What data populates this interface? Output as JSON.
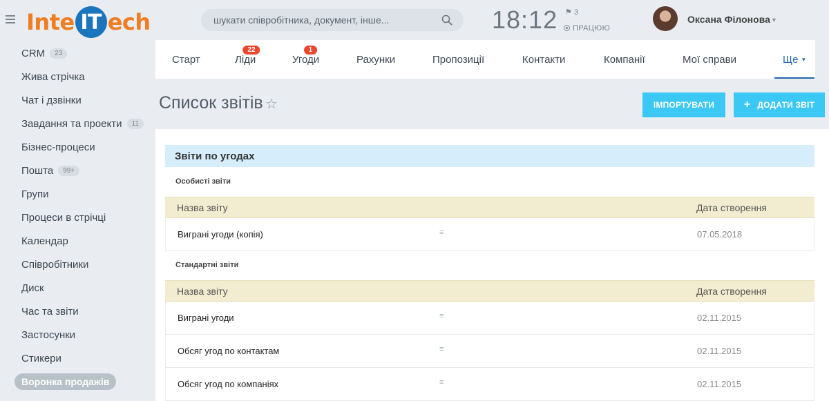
{
  "header": {
    "logo_pre": "Inte",
    "logo_mid": "IT",
    "logo_post": "ech",
    "search_placeholder": "шукати співробітника, документ, інше...",
    "clock": "18:12",
    "flag_count": "3",
    "work_status": "ПРАЦЮЮ",
    "user_name": "Оксана Філонова"
  },
  "sidebar": {
    "items": [
      {
        "label": "CRM",
        "count": "23"
      },
      {
        "label": "Жива стрічка"
      },
      {
        "label": "Чат і дзвінки"
      },
      {
        "label": "Завдання та проекти",
        "count": "11"
      },
      {
        "label": "Бізнес-процеси"
      },
      {
        "label": "Пошта",
        "count": "99+"
      },
      {
        "label": "Групи"
      },
      {
        "label": "Процеси в стрічці"
      },
      {
        "label": "Календар"
      },
      {
        "label": "Співробітники"
      },
      {
        "label": "Диск"
      },
      {
        "label": "Час та звіти"
      },
      {
        "label": "Застосунки"
      },
      {
        "label": "Стикери"
      },
      {
        "label": "Воронка продажів"
      }
    ]
  },
  "topnav": {
    "tabs": [
      {
        "label": "Старт"
      },
      {
        "label": "Ліди",
        "badge": "22"
      },
      {
        "label": "Угоди",
        "badge": "1"
      },
      {
        "label": "Рахунки"
      },
      {
        "label": "Пропозиції"
      },
      {
        "label": "Контакти"
      },
      {
        "label": "Компанії"
      },
      {
        "label": "Мої справи"
      },
      {
        "label": "Ще"
      }
    ]
  },
  "page": {
    "title": "Список звітів",
    "import_label": "ІМПОРТУВАТИ",
    "add_label": "ДОДАТИ ЗВІТ"
  },
  "reports": {
    "section_title": "Звіти по угодах",
    "col_name": "Назва звіту",
    "col_date": "Дата створення",
    "personal_label": "Особисті звіти",
    "personal": [
      {
        "name": "Виграні угоди (копія)",
        "date": "07.05.2018"
      }
    ],
    "standard_label": "Стандартні звіти",
    "standard": [
      {
        "name": "Виграні угоди",
        "date": "02.11.2015"
      },
      {
        "name": "Обсяг угод по контактам",
        "date": "02.11.2015"
      },
      {
        "name": "Обсяг угод по компаніях",
        "date": "02.11.2015"
      }
    ]
  },
  "colors": {
    "accent": "#3bc8f5",
    "logo_orange": "#ef7d22",
    "logo_blue": "#1b75bc",
    "badge_red": "#f0462e",
    "section_bg": "#d6eefb",
    "thead_bg": "#f2ecd0"
  }
}
